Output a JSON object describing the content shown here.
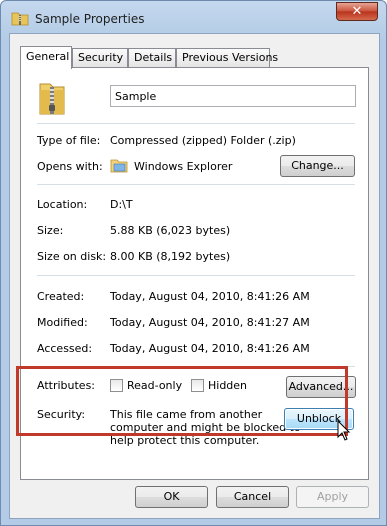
{
  "window": {
    "title": "Sample Properties",
    "close_glyph": "✕"
  },
  "tabs": [
    {
      "label": "General",
      "active": true
    },
    {
      "label": "Security",
      "active": false
    },
    {
      "label": "Details",
      "active": false
    },
    {
      "label": "Previous Versions",
      "active": false
    }
  ],
  "general": {
    "file_name": "Sample",
    "type_label": "Type of file:",
    "type_value": "Compressed (zipped) Folder (.zip)",
    "opens_label": "Opens with:",
    "opens_value": "Windows Explorer",
    "change_button": "Change...",
    "location_label": "Location:",
    "location_value": "D:\\T",
    "size_label": "Size:",
    "size_value": "5.88 KB (6,023 bytes)",
    "size_disk_label": "Size on disk:",
    "size_disk_value": "8.00 KB (8,192 bytes)",
    "created_label": "Created:",
    "created_value": "Today, August 04, 2010, 8:41:26 AM",
    "modified_label": "Modified:",
    "modified_value": "Today, August 04, 2010, 8:41:27 AM",
    "accessed_label": "Accessed:",
    "accessed_value": "Today, August 04, 2010, 8:41:26 AM",
    "attributes_label": "Attributes:",
    "readonly_label": "Read-only",
    "hidden_label": "Hidden",
    "advanced_button": "Advanced...",
    "security_label": "Security:",
    "security_text": [
      "This file came from another",
      "computer and might be blocked to",
      "help protect this computer."
    ],
    "unblock_button": "Unblock"
  },
  "footer": {
    "ok_button": "OK",
    "cancel_button": "Cancel",
    "apply_button": "Apply"
  },
  "colors": {
    "highlight": "#c0392b",
    "close_button": "#c7503a"
  }
}
